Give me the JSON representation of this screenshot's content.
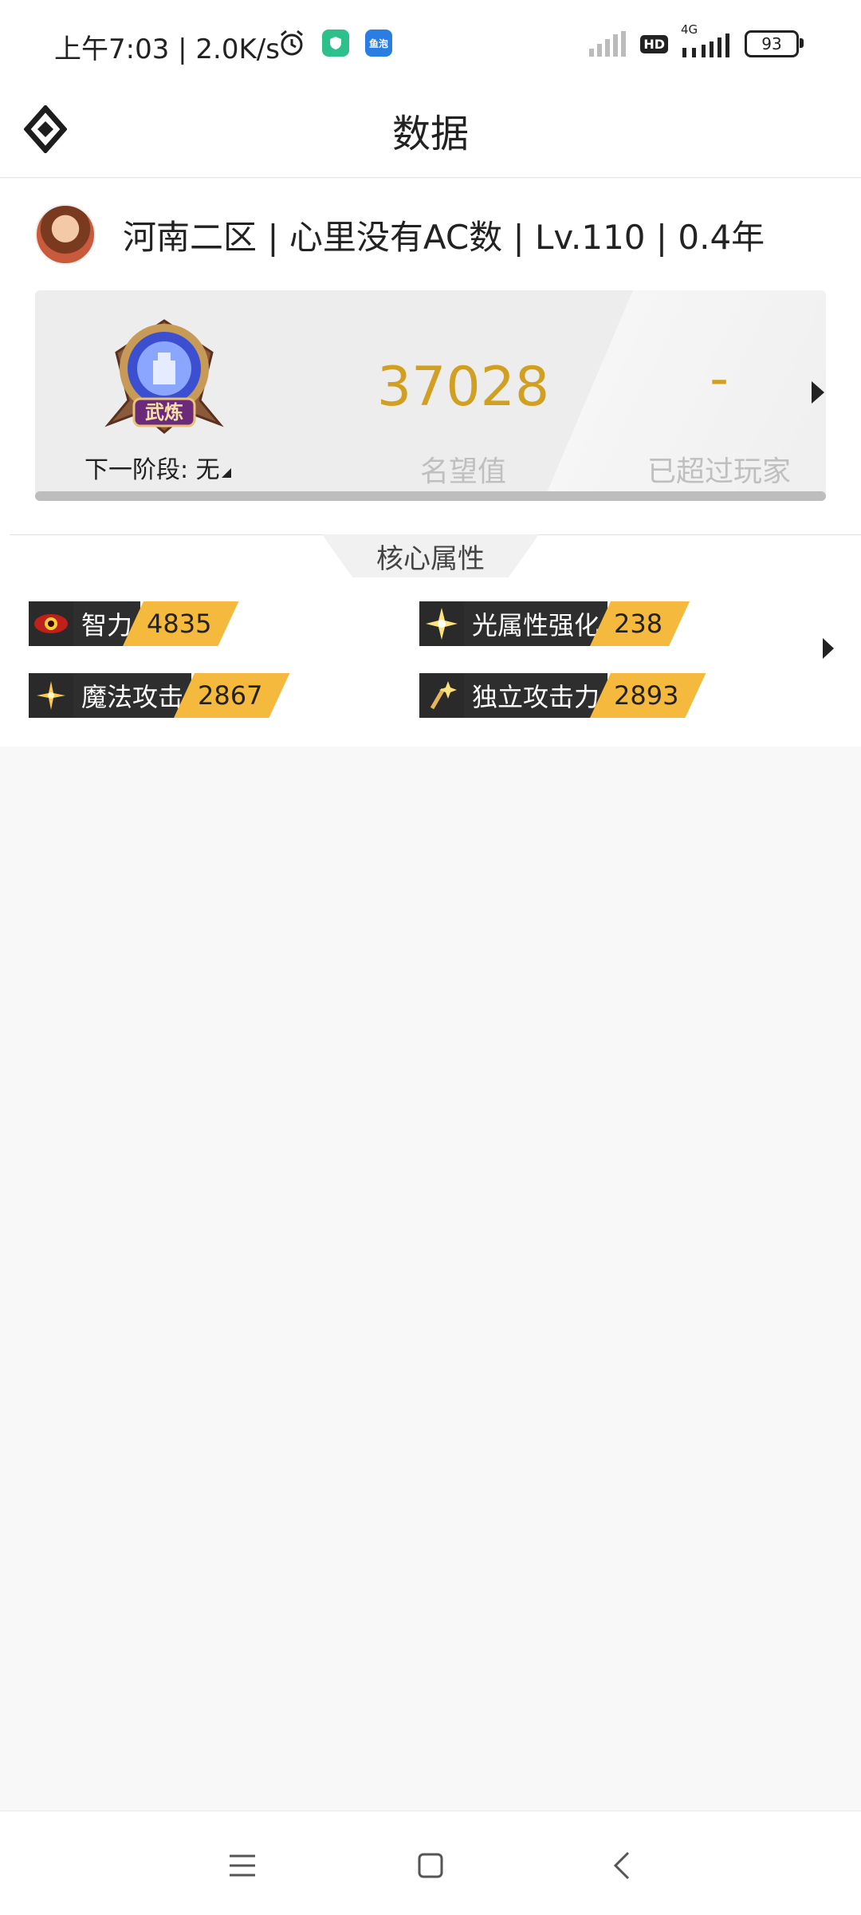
{
  "status_bar": {
    "time_speed": "上午7:03 | 2.0K/s",
    "app_badge_label": "鱼泡",
    "network": "4G",
    "hd": "HD",
    "battery": "93"
  },
  "header": {
    "title": "数据"
  },
  "profile": {
    "line": "河南二区 | 心里没有AC数 | Lv.110 | 0.4年"
  },
  "rank_panel": {
    "badge_text": "武炼",
    "next_stage": "下一阶段: 无",
    "fame_value": "37028",
    "fame_label": "名望值",
    "rank_value": "-",
    "rank_label": "已超过玩家",
    "progress_fraction": 1.0
  },
  "core_attributes": {
    "section_title": "核心属性",
    "items": [
      {
        "name": "智力",
        "value": "4835",
        "icon": "eye-icon"
      },
      {
        "name": "光属性强化",
        "value": "238",
        "icon": "light-sparkle-icon"
      },
      {
        "name": "魔法攻击",
        "value": "2867",
        "icon": "magic-star-icon"
      },
      {
        "name": "独立攻击力",
        "value": "2893",
        "icon": "sword-sparkle-icon"
      }
    ]
  },
  "colors": {
    "accent_gold": "#d1a022",
    "value_tag": "#f5b93d",
    "attr_dark": "#2e2e2e"
  }
}
